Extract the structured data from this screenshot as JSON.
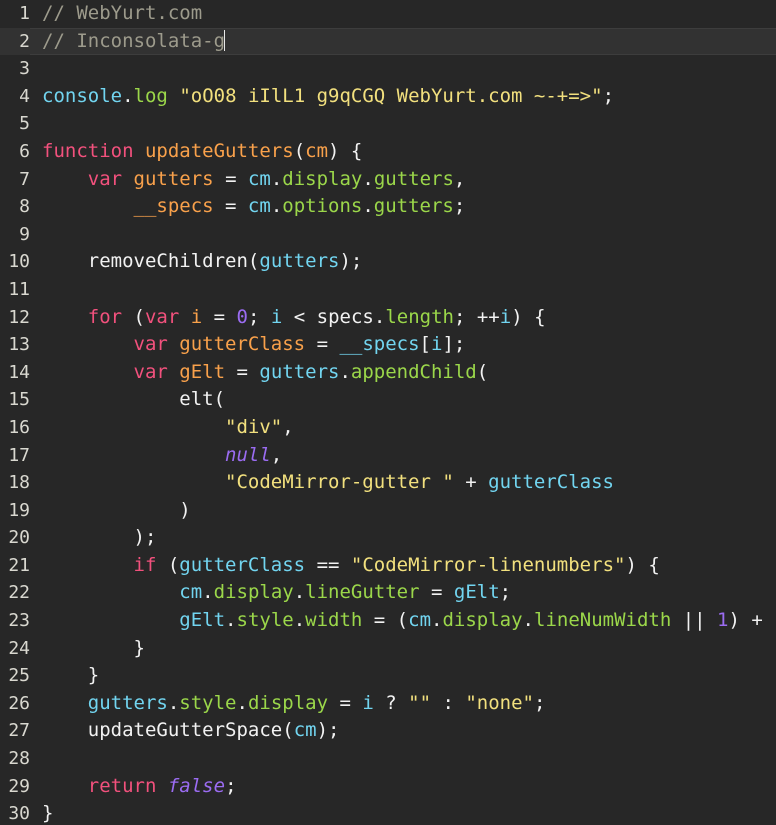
{
  "editor": {
    "title": "code-editor",
    "theme_name": "dark",
    "colors": {
      "background": "#272727",
      "active_line_background": "#323232",
      "gutter_text": "#d9d8d0",
      "default_text": "#f2f2f2",
      "comment": "#9d9b8c",
      "keyword": "#f2517d",
      "definition": "#f9a14b",
      "variable": "#72d5f0",
      "property": "#9bd74a",
      "string": "#f2e07e",
      "number": "#9b6cf2",
      "atom": "#9b6cf2",
      "cursor": "#e8e8e8"
    },
    "active_line": 2,
    "cursor_line": 2,
    "cursor_column": 18,
    "total_lines": 30,
    "lines": [
      {
        "number": "1",
        "tokens": [
          {
            "text": "// WebYurt.com",
            "type": "comment"
          }
        ]
      },
      {
        "number": "2",
        "tokens": [
          {
            "text": "// Inconsolata-g",
            "type": "comment"
          },
          {
            "text": "",
            "type": "cursor"
          }
        ]
      },
      {
        "number": "3",
        "tokens": []
      },
      {
        "number": "4",
        "tokens": [
          {
            "text": "console",
            "type": "var"
          },
          {
            "text": ".",
            "type": "plain"
          },
          {
            "text": "log",
            "type": "prop"
          },
          {
            "text": " ",
            "type": "plain"
          },
          {
            "text": "\"oO08 iIlL1 g9qCGQ WebYurt.com ~-+=>\"",
            "type": "string"
          },
          {
            "text": ";",
            "type": "plain"
          }
        ]
      },
      {
        "number": "5",
        "tokens": []
      },
      {
        "number": "6",
        "tokens": [
          {
            "text": "function",
            "type": "keyword"
          },
          {
            "text": " ",
            "type": "plain"
          },
          {
            "text": "updateGutters",
            "type": "def"
          },
          {
            "text": "(",
            "type": "plain"
          },
          {
            "text": "cm",
            "type": "def"
          },
          {
            "text": ") {",
            "type": "plain"
          }
        ]
      },
      {
        "number": "7",
        "tokens": [
          {
            "text": "    ",
            "type": "plain"
          },
          {
            "text": "var",
            "type": "keyword"
          },
          {
            "text": " ",
            "type": "plain"
          },
          {
            "text": "gutters",
            "type": "def"
          },
          {
            "text": " = ",
            "type": "plain"
          },
          {
            "text": "cm",
            "type": "var"
          },
          {
            "text": ".",
            "type": "plain"
          },
          {
            "text": "display",
            "type": "prop"
          },
          {
            "text": ".",
            "type": "plain"
          },
          {
            "text": "gutters",
            "type": "prop"
          },
          {
            "text": ",",
            "type": "plain"
          }
        ]
      },
      {
        "number": "8",
        "tokens": [
          {
            "text": "        ",
            "type": "plain"
          },
          {
            "text": "__specs",
            "type": "def"
          },
          {
            "text": " = ",
            "type": "plain"
          },
          {
            "text": "cm",
            "type": "var"
          },
          {
            "text": ".",
            "type": "plain"
          },
          {
            "text": "options",
            "type": "prop"
          },
          {
            "text": ".",
            "type": "plain"
          },
          {
            "text": "gutters",
            "type": "prop"
          },
          {
            "text": ";",
            "type": "plain"
          }
        ]
      },
      {
        "number": "9",
        "tokens": []
      },
      {
        "number": "10",
        "tokens": [
          {
            "text": "    ",
            "type": "plain"
          },
          {
            "text": "removeChildren",
            "type": "plain"
          },
          {
            "text": "(",
            "type": "plain"
          },
          {
            "text": "gutters",
            "type": "var"
          },
          {
            "text": ");",
            "type": "plain"
          }
        ]
      },
      {
        "number": "11",
        "tokens": []
      },
      {
        "number": "12",
        "tokens": [
          {
            "text": "    ",
            "type": "plain"
          },
          {
            "text": "for",
            "type": "keyword"
          },
          {
            "text": " (",
            "type": "plain"
          },
          {
            "text": "var",
            "type": "keyword"
          },
          {
            "text": " ",
            "type": "plain"
          },
          {
            "text": "i",
            "type": "def"
          },
          {
            "text": " = ",
            "type": "plain"
          },
          {
            "text": "0",
            "type": "number"
          },
          {
            "text": "; ",
            "type": "plain"
          },
          {
            "text": "i",
            "type": "var"
          },
          {
            "text": " < ",
            "type": "plain"
          },
          {
            "text": "specs",
            "type": "plain"
          },
          {
            "text": ".",
            "type": "plain"
          },
          {
            "text": "length",
            "type": "prop"
          },
          {
            "text": "; ++",
            "type": "plain"
          },
          {
            "text": "i",
            "type": "var"
          },
          {
            "text": ") {",
            "type": "plain"
          }
        ]
      },
      {
        "number": "13",
        "tokens": [
          {
            "text": "        ",
            "type": "plain"
          },
          {
            "text": "var",
            "type": "keyword"
          },
          {
            "text": " ",
            "type": "plain"
          },
          {
            "text": "gutterClass",
            "type": "def"
          },
          {
            "text": " = ",
            "type": "plain"
          },
          {
            "text": "__specs",
            "type": "var"
          },
          {
            "text": "[",
            "type": "plain"
          },
          {
            "text": "i",
            "type": "var"
          },
          {
            "text": "];",
            "type": "plain"
          }
        ]
      },
      {
        "number": "14",
        "tokens": [
          {
            "text": "        ",
            "type": "plain"
          },
          {
            "text": "var",
            "type": "keyword"
          },
          {
            "text": " ",
            "type": "plain"
          },
          {
            "text": "gElt",
            "type": "def"
          },
          {
            "text": " = ",
            "type": "plain"
          },
          {
            "text": "gutters",
            "type": "var"
          },
          {
            "text": ".",
            "type": "plain"
          },
          {
            "text": "appendChild",
            "type": "prop"
          },
          {
            "text": "(",
            "type": "plain"
          }
        ]
      },
      {
        "number": "15",
        "tokens": [
          {
            "text": "            ",
            "type": "plain"
          },
          {
            "text": "elt",
            "type": "plain"
          },
          {
            "text": "(",
            "type": "plain"
          }
        ]
      },
      {
        "number": "16",
        "tokens": [
          {
            "text": "                ",
            "type": "plain"
          },
          {
            "text": "\"div\"",
            "type": "string"
          },
          {
            "text": ",",
            "type": "plain"
          }
        ]
      },
      {
        "number": "17",
        "tokens": [
          {
            "text": "                ",
            "type": "plain"
          },
          {
            "text": "null",
            "type": "atom"
          },
          {
            "text": ",",
            "type": "plain"
          }
        ]
      },
      {
        "number": "18",
        "tokens": [
          {
            "text": "                ",
            "type": "plain"
          },
          {
            "text": "\"CodeMirror-gutter \"",
            "type": "string"
          },
          {
            "text": " + ",
            "type": "plain"
          },
          {
            "text": "gutterClass",
            "type": "var"
          }
        ]
      },
      {
        "number": "19",
        "tokens": [
          {
            "text": "            )",
            "type": "plain"
          }
        ]
      },
      {
        "number": "20",
        "tokens": [
          {
            "text": "        );",
            "type": "plain"
          }
        ]
      },
      {
        "number": "21",
        "tokens": [
          {
            "text": "        ",
            "type": "plain"
          },
          {
            "text": "if",
            "type": "keyword"
          },
          {
            "text": " (",
            "type": "plain"
          },
          {
            "text": "gutterClass",
            "type": "var"
          },
          {
            "text": " == ",
            "type": "plain"
          },
          {
            "text": "\"CodeMirror-linenumbers\"",
            "type": "string"
          },
          {
            "text": ") {",
            "type": "plain"
          }
        ]
      },
      {
        "number": "22",
        "tokens": [
          {
            "text": "            ",
            "type": "plain"
          },
          {
            "text": "cm",
            "type": "var"
          },
          {
            "text": ".",
            "type": "plain"
          },
          {
            "text": "display",
            "type": "prop"
          },
          {
            "text": ".",
            "type": "plain"
          },
          {
            "text": "lineGutter",
            "type": "prop"
          },
          {
            "text": " = ",
            "type": "plain"
          },
          {
            "text": "gElt",
            "type": "var"
          },
          {
            "text": ";",
            "type": "plain"
          }
        ]
      },
      {
        "number": "23",
        "tokens": [
          {
            "text": "            ",
            "type": "plain"
          },
          {
            "text": "gElt",
            "type": "var"
          },
          {
            "text": ".",
            "type": "plain"
          },
          {
            "text": "style",
            "type": "prop"
          },
          {
            "text": ".",
            "type": "plain"
          },
          {
            "text": "width",
            "type": "prop"
          },
          {
            "text": " = (",
            "type": "plain"
          },
          {
            "text": "cm",
            "type": "var"
          },
          {
            "text": ".",
            "type": "plain"
          },
          {
            "text": "display",
            "type": "prop"
          },
          {
            "text": ".",
            "type": "plain"
          },
          {
            "text": "lineNumWidth",
            "type": "prop"
          },
          {
            "text": " || ",
            "type": "plain"
          },
          {
            "text": "1",
            "type": "number"
          },
          {
            "text": ") +",
            "type": "plain"
          }
        ]
      },
      {
        "number": "24",
        "tokens": [
          {
            "text": "        }",
            "type": "plain"
          }
        ]
      },
      {
        "number": "25",
        "tokens": [
          {
            "text": "    }",
            "type": "plain"
          }
        ]
      },
      {
        "number": "26",
        "tokens": [
          {
            "text": "    ",
            "type": "plain"
          },
          {
            "text": "gutters",
            "type": "var"
          },
          {
            "text": ".",
            "type": "plain"
          },
          {
            "text": "style",
            "type": "prop"
          },
          {
            "text": ".",
            "type": "plain"
          },
          {
            "text": "display",
            "type": "prop"
          },
          {
            "text": " = ",
            "type": "plain"
          },
          {
            "text": "i",
            "type": "var"
          },
          {
            "text": " ? ",
            "type": "plain"
          },
          {
            "text": "\"\"",
            "type": "string"
          },
          {
            "text": " : ",
            "type": "plain"
          },
          {
            "text": "\"none\"",
            "type": "string"
          },
          {
            "text": ";",
            "type": "plain"
          }
        ]
      },
      {
        "number": "27",
        "tokens": [
          {
            "text": "    ",
            "type": "plain"
          },
          {
            "text": "updateGutterSpace",
            "type": "plain"
          },
          {
            "text": "(",
            "type": "plain"
          },
          {
            "text": "cm",
            "type": "var"
          },
          {
            "text": ");",
            "type": "plain"
          }
        ]
      },
      {
        "number": "28",
        "tokens": []
      },
      {
        "number": "29",
        "tokens": [
          {
            "text": "    ",
            "type": "plain"
          },
          {
            "text": "return",
            "type": "keyword"
          },
          {
            "text": " ",
            "type": "plain"
          },
          {
            "text": "false",
            "type": "atom"
          },
          {
            "text": ";",
            "type": "plain"
          }
        ]
      },
      {
        "number": "30",
        "tokens": [
          {
            "text": "}",
            "type": "plain"
          }
        ]
      }
    ]
  }
}
